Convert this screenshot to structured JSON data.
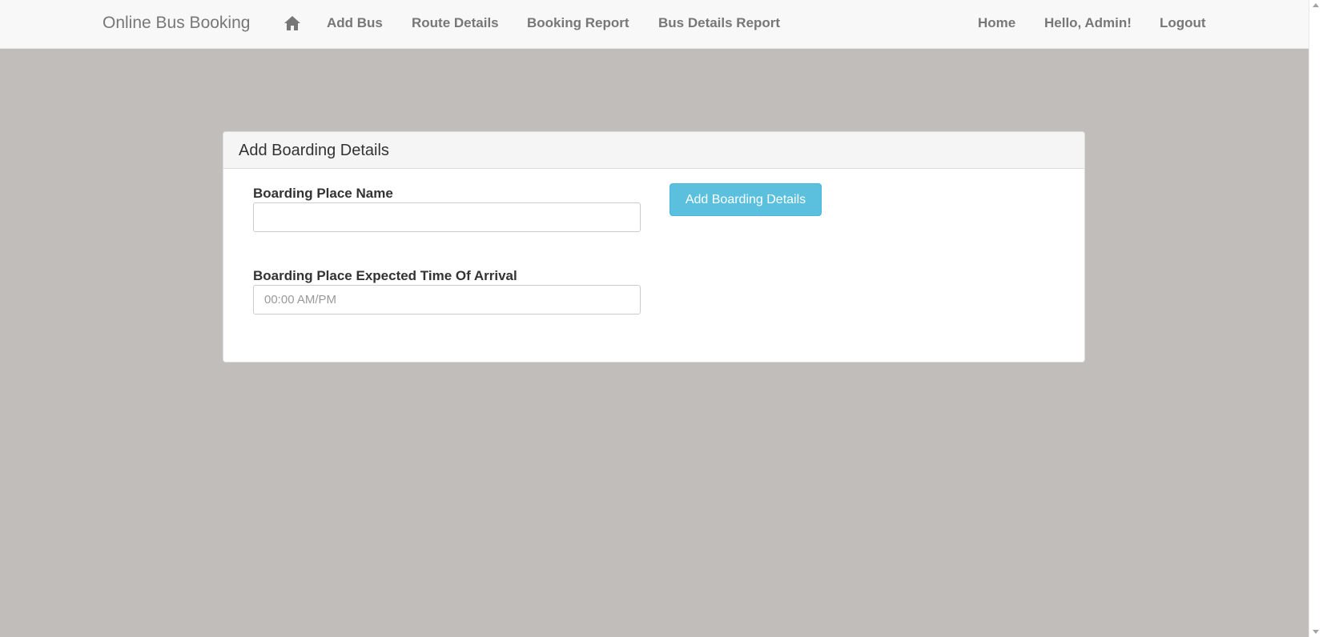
{
  "navbar": {
    "brand": "Online Bus Booking",
    "home_icon": "home-icon",
    "left_links": [
      "Add Bus",
      "Route Details",
      "Booking Report",
      "Bus Details Report"
    ],
    "right_links": [
      "Home",
      "Hello, Admin!",
      "Logout"
    ]
  },
  "panel": {
    "title": "Add Boarding Details",
    "boarding_place_label": "Boarding Place Name",
    "boarding_place_value": "",
    "arrival_label": "Boarding Place Expected Time Of Arrival",
    "arrival_placeholder": "00:00 AM/PM",
    "submit_label": "Add Boarding Details"
  },
  "colors": {
    "page_bg": "#c1bdba",
    "navbar_bg": "#f8f8f8",
    "button_bg": "#5bc0de"
  }
}
